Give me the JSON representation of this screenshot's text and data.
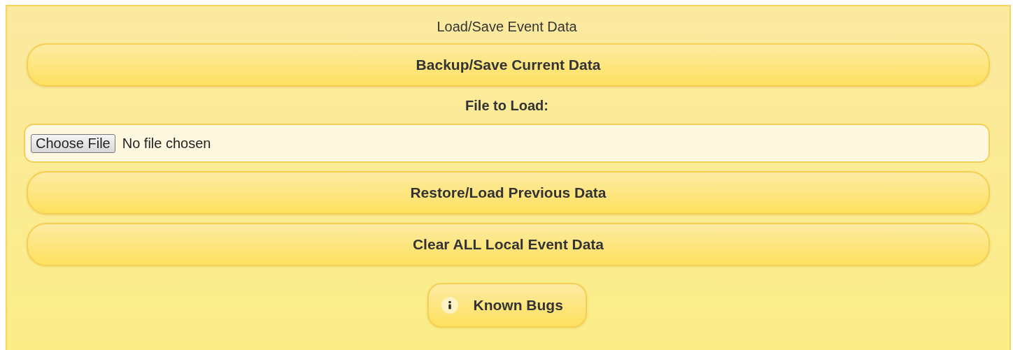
{
  "title": "Load/Save Event Data",
  "backup_button": "Backup/Save Current Data",
  "file_label": "File to Load:",
  "file_field": {
    "button": "Choose File",
    "value": "No file chosen"
  },
  "action_buttons": [
    "Restore/Load Previous Data",
    "Clear ALL Local Event Data"
  ],
  "bugs_button": "Known Bugs"
}
